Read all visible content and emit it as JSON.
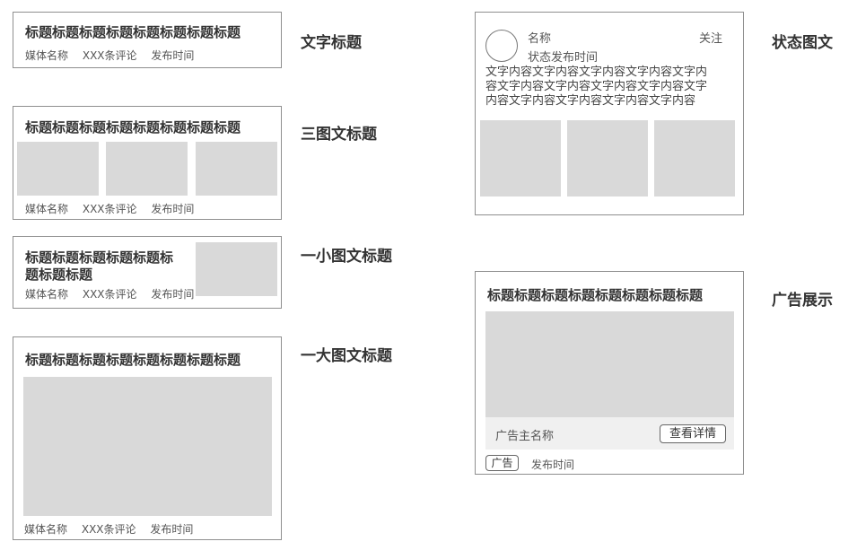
{
  "text_title_card": {
    "title": "标题标题标题标题标题标题标题标题",
    "media": "媒体名称",
    "comments": "XXX条评论",
    "time": "发布时间",
    "label": "文字标题"
  },
  "three_image_card": {
    "title": "标题标题标题标题标题标题标题标题",
    "media": "媒体名称",
    "comments": "XXX条评论",
    "time": "发布时间",
    "label": "三图文标题"
  },
  "small_image_card": {
    "title_line1": "标题标题标题标题标题标",
    "title_line2": "题标题标题",
    "media": "媒体名称",
    "comments": "XXX条评论",
    "time": "发布时间",
    "label": "一小图文标题"
  },
  "large_image_card": {
    "title": "标题标题标题标题标题标题标题标题",
    "media": "媒体名称",
    "comments": "XXX条评论",
    "time": "发布时间",
    "label": "一大图文标题"
  },
  "status_card": {
    "name": "名称",
    "follow": "关注",
    "status_time": "状态发布时间",
    "content_line1": "文字内容文字内容文字内容文字内容文字内",
    "content_line2": "容文字内容文字内容文字内容文字内容文字",
    "content_line3": "内容文字内容文字内容文字内容文字内容",
    "label": "状态图文"
  },
  "ad_card": {
    "title": "标题标题标题标题标题标题标题标题",
    "advertiser": "广告主名称",
    "details_button": "查看详情",
    "ad_badge": "广告",
    "time": "发布时间",
    "label": "广告展示"
  }
}
